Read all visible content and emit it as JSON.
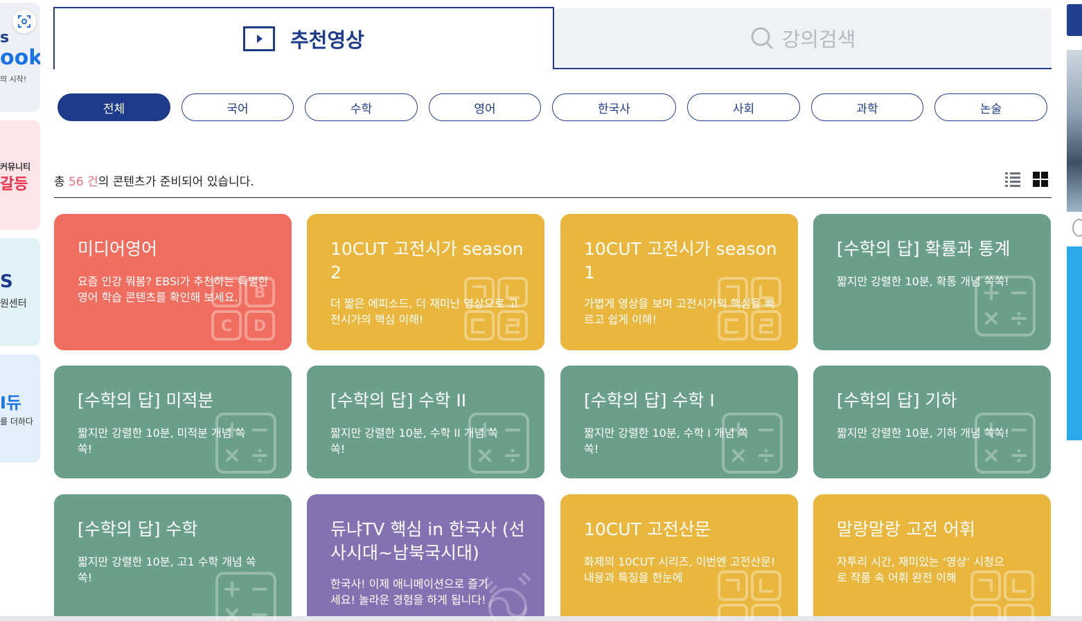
{
  "left_sidebar": {
    "items": [
      {
        "line1": "s",
        "line2": "ook",
        "line3": "의 시작!"
      },
      {
        "line1": "커뮤니티",
        "line2": "갈등"
      },
      {
        "line1": "S",
        "line2": "원센터"
      },
      {
        "line1": "I듀",
        "line2": "를 더하다"
      }
    ]
  },
  "tabs": [
    {
      "label": "추천영상",
      "active": true,
      "icon": "play-icon"
    },
    {
      "label": "강의검색",
      "active": false,
      "icon": "search-icon"
    }
  ],
  "filters": [
    {
      "label": "전체",
      "active": true
    },
    {
      "label": "국어",
      "active": false
    },
    {
      "label": "수학",
      "active": false
    },
    {
      "label": "영어",
      "active": false
    },
    {
      "label": "한국사",
      "active": false
    },
    {
      "label": "사회",
      "active": false
    },
    {
      "label": "과학",
      "active": false
    },
    {
      "label": "논술",
      "active": false
    }
  ],
  "count": {
    "prefix": "총",
    "number": "56 건",
    "suffix": "의 콘텐츠가 준비되어 있습니다."
  },
  "view_modes": [
    "list-view-icon",
    "grid-view-icon"
  ],
  "cards": [
    {
      "title": "미디어영어",
      "desc": "요즘 인강 뭐봄? EBSi가 추천하는 특별한 영어 학습 콘텐츠를 확인해 보세요.",
      "color": "#f06e5f",
      "icon": "abcd-icon"
    },
    {
      "title": "10CUT 고전시가 season 2",
      "desc": "더 짧은 에피소드, 더 재미난 영상으로 고전시가의 핵심 이해!",
      "color": "#e9b63e",
      "icon": "hangul-icon"
    },
    {
      "title": "10CUT 고전시가 season 1",
      "desc": "가볍게 영상을 보며 고전시가의 핵심을 빠르고 쉽게 이해!",
      "color": "#e9b63e",
      "icon": "hangul-icon"
    },
    {
      "title": "[수학의 답] 확률과 통계",
      "desc": "짧지만 강렬한 10분, 확통 개념 쏙쏙!",
      "color": "#6aa08b",
      "icon": "math-ops-icon"
    },
    {
      "title": "[수학의 답] 미적분",
      "desc": "짧지만 강렬한 10분, 미적분 개념 쏙쏙!",
      "color": "#6aa08b",
      "icon": "math-ops-icon"
    },
    {
      "title": "[수학의 답] 수학 II",
      "desc": "짧지만 강렬한 10분, 수학 II 개념 쏙쏙!",
      "color": "#6aa08b",
      "icon": "math-ops-icon"
    },
    {
      "title": "[수학의 답] 수학 I",
      "desc": "짧지만 강렬한 10분, 수학 I 개념 쏙쏙!",
      "color": "#6aa08b",
      "icon": "math-ops-icon"
    },
    {
      "title": "[수학의 답] 기하",
      "desc": "짧지만 강렬한 10분, 기하 개념 쏙쏙!",
      "color": "#6aa08b",
      "icon": "math-ops-icon"
    },
    {
      "title": "[수학의 답] 수학",
      "desc": "짧지만 강렬한 10분, 고1 수학 개념 쏙쏙!",
      "color": "#6aa08b",
      "icon": "math-ops-icon"
    },
    {
      "title": "듀냐TV 핵심 in 한국사 (선사시대~남북국시대)",
      "desc": "한국사! 이제 애니메이션으로 즐기세요! 놀라운 경험을 하게 됩니다!",
      "color": "#8471b2",
      "icon": "taegeuk-icon"
    },
    {
      "title": "10CUT 고전산문",
      "desc": "화제의 10CUT 시리즈, 이번엔 고전산문! 내용과 특징을 한눈에",
      "color": "#e9b63e",
      "icon": "hangul-icon"
    },
    {
      "title": "말랑말랑 고전 어휘",
      "desc": "자투리 시간, 재미있는 ‘영상‘ 시청으로 작품 속 어휘 완전 이해",
      "color": "#e9b63e",
      "icon": "hangul-icon"
    }
  ]
}
